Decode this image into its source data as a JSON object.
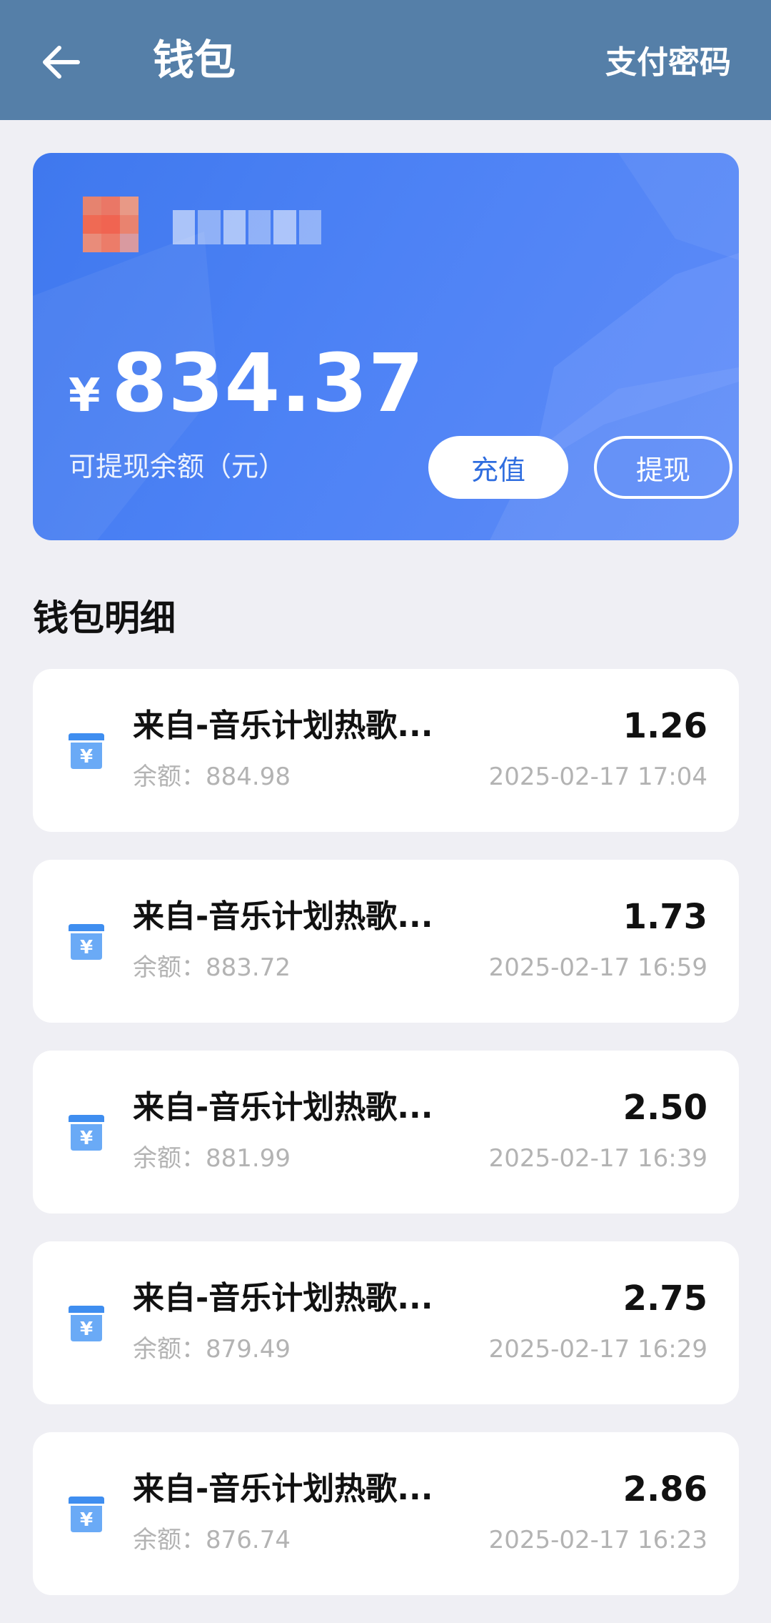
{
  "header": {
    "title": "钱包",
    "action": "支付密码",
    "background": "#557fa8"
  },
  "balance": {
    "currency": "¥",
    "amount": "834.37",
    "caption": "可提现余额（元）",
    "recharge_label": "充值",
    "withdraw_label": "提现",
    "card_color": "#4d82f5"
  },
  "section_title": "钱包明细",
  "transactions": [
    {
      "title": "来自-音乐计划热歌...",
      "amount": "1.26",
      "balance": "余额：884.98",
      "time": "2025-02-17 17:04"
    },
    {
      "title": "来自-音乐计划热歌...",
      "amount": "1.73",
      "balance": "余额：883.72",
      "time": "2025-02-17 16:59"
    },
    {
      "title": "来自-音乐计划热歌...",
      "amount": "2.50",
      "balance": "余额：881.99",
      "time": "2025-02-17 16:39"
    },
    {
      "title": "来自-音乐计划热歌...",
      "amount": "2.75",
      "balance": "余额：879.49",
      "time": "2025-02-17 16:29"
    },
    {
      "title": "来自-音乐计划热歌...",
      "amount": "2.86",
      "balance": "余额：876.74",
      "time": "2025-02-17 16:23"
    }
  ],
  "icons": {
    "back": "arrow-left-icon",
    "transaction": "wallet-yuan-icon"
  }
}
